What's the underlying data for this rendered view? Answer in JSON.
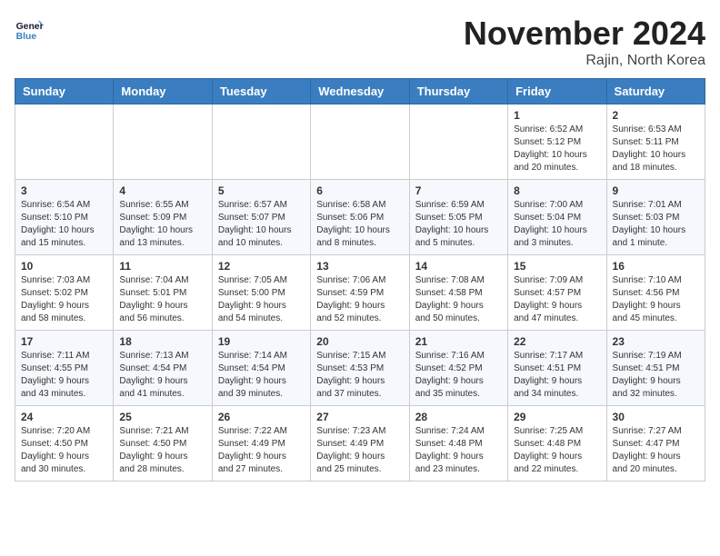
{
  "header": {
    "logo_line1": "General",
    "logo_line2": "Blue",
    "month": "November 2024",
    "location": "Rajin, North Korea"
  },
  "days_of_week": [
    "Sunday",
    "Monday",
    "Tuesday",
    "Wednesday",
    "Thursday",
    "Friday",
    "Saturday"
  ],
  "weeks": [
    [
      {
        "day": "",
        "info": ""
      },
      {
        "day": "",
        "info": ""
      },
      {
        "day": "",
        "info": ""
      },
      {
        "day": "",
        "info": ""
      },
      {
        "day": "",
        "info": ""
      },
      {
        "day": "1",
        "info": "Sunrise: 6:52 AM\nSunset: 5:12 PM\nDaylight: 10 hours\nand 20 minutes."
      },
      {
        "day": "2",
        "info": "Sunrise: 6:53 AM\nSunset: 5:11 PM\nDaylight: 10 hours\nand 18 minutes."
      }
    ],
    [
      {
        "day": "3",
        "info": "Sunrise: 6:54 AM\nSunset: 5:10 PM\nDaylight: 10 hours\nand 15 minutes."
      },
      {
        "day": "4",
        "info": "Sunrise: 6:55 AM\nSunset: 5:09 PM\nDaylight: 10 hours\nand 13 minutes."
      },
      {
        "day": "5",
        "info": "Sunrise: 6:57 AM\nSunset: 5:07 PM\nDaylight: 10 hours\nand 10 minutes."
      },
      {
        "day": "6",
        "info": "Sunrise: 6:58 AM\nSunset: 5:06 PM\nDaylight: 10 hours\nand 8 minutes."
      },
      {
        "day": "7",
        "info": "Sunrise: 6:59 AM\nSunset: 5:05 PM\nDaylight: 10 hours\nand 5 minutes."
      },
      {
        "day": "8",
        "info": "Sunrise: 7:00 AM\nSunset: 5:04 PM\nDaylight: 10 hours\nand 3 minutes."
      },
      {
        "day": "9",
        "info": "Sunrise: 7:01 AM\nSunset: 5:03 PM\nDaylight: 10 hours\nand 1 minute."
      }
    ],
    [
      {
        "day": "10",
        "info": "Sunrise: 7:03 AM\nSunset: 5:02 PM\nDaylight: 9 hours\nand 58 minutes."
      },
      {
        "day": "11",
        "info": "Sunrise: 7:04 AM\nSunset: 5:01 PM\nDaylight: 9 hours\nand 56 minutes."
      },
      {
        "day": "12",
        "info": "Sunrise: 7:05 AM\nSunset: 5:00 PM\nDaylight: 9 hours\nand 54 minutes."
      },
      {
        "day": "13",
        "info": "Sunrise: 7:06 AM\nSunset: 4:59 PM\nDaylight: 9 hours\nand 52 minutes."
      },
      {
        "day": "14",
        "info": "Sunrise: 7:08 AM\nSunset: 4:58 PM\nDaylight: 9 hours\nand 50 minutes."
      },
      {
        "day": "15",
        "info": "Sunrise: 7:09 AM\nSunset: 4:57 PM\nDaylight: 9 hours\nand 47 minutes."
      },
      {
        "day": "16",
        "info": "Sunrise: 7:10 AM\nSunset: 4:56 PM\nDaylight: 9 hours\nand 45 minutes."
      }
    ],
    [
      {
        "day": "17",
        "info": "Sunrise: 7:11 AM\nSunset: 4:55 PM\nDaylight: 9 hours\nand 43 minutes."
      },
      {
        "day": "18",
        "info": "Sunrise: 7:13 AM\nSunset: 4:54 PM\nDaylight: 9 hours\nand 41 minutes."
      },
      {
        "day": "19",
        "info": "Sunrise: 7:14 AM\nSunset: 4:54 PM\nDaylight: 9 hours\nand 39 minutes."
      },
      {
        "day": "20",
        "info": "Sunrise: 7:15 AM\nSunset: 4:53 PM\nDaylight: 9 hours\nand 37 minutes."
      },
      {
        "day": "21",
        "info": "Sunrise: 7:16 AM\nSunset: 4:52 PM\nDaylight: 9 hours\nand 35 minutes."
      },
      {
        "day": "22",
        "info": "Sunrise: 7:17 AM\nSunset: 4:51 PM\nDaylight: 9 hours\nand 34 minutes."
      },
      {
        "day": "23",
        "info": "Sunrise: 7:19 AM\nSunset: 4:51 PM\nDaylight: 9 hours\nand 32 minutes."
      }
    ],
    [
      {
        "day": "24",
        "info": "Sunrise: 7:20 AM\nSunset: 4:50 PM\nDaylight: 9 hours\nand 30 minutes."
      },
      {
        "day": "25",
        "info": "Sunrise: 7:21 AM\nSunset: 4:50 PM\nDaylight: 9 hours\nand 28 minutes."
      },
      {
        "day": "26",
        "info": "Sunrise: 7:22 AM\nSunset: 4:49 PM\nDaylight: 9 hours\nand 27 minutes."
      },
      {
        "day": "27",
        "info": "Sunrise: 7:23 AM\nSunset: 4:49 PM\nDaylight: 9 hours\nand 25 minutes."
      },
      {
        "day": "28",
        "info": "Sunrise: 7:24 AM\nSunset: 4:48 PM\nDaylight: 9 hours\nand 23 minutes."
      },
      {
        "day": "29",
        "info": "Sunrise: 7:25 AM\nSunset: 4:48 PM\nDaylight: 9 hours\nand 22 minutes."
      },
      {
        "day": "30",
        "info": "Sunrise: 7:27 AM\nSunset: 4:47 PM\nDaylight: 9 hours\nand 20 minutes."
      }
    ]
  ]
}
